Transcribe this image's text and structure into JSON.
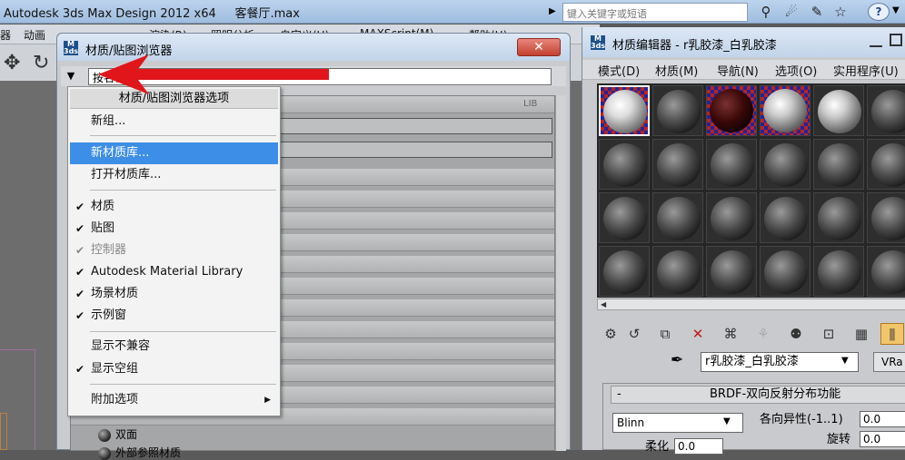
{
  "app": {
    "title": "Autodesk 3ds Max Design 2012 x64",
    "file": "客餐厅.max",
    "search_placeholder": "键入关键字或短语",
    "help": "?"
  },
  "main_menu": [
    "器",
    "动画",
    "渲染(R)",
    "照明分析",
    "自定义(U)",
    "MAXScript(M)",
    "帮助(H)"
  ],
  "browser": {
    "title": "材质/贴图浏览器",
    "close": "✕",
    "search_value": "按名称...",
    "lib_tag": "LIB",
    "rows": [
      "双面",
      "外部参照材质"
    ]
  },
  "context_menu": {
    "header": "材质/贴图浏览器选项",
    "items": [
      {
        "label": "新组...",
        "checked": false,
        "disabled": false,
        "highlighted": false
      },
      {
        "label": "新材质库...",
        "checked": false,
        "disabled": false,
        "highlighted": true
      },
      {
        "label": "打开材质库...",
        "checked": false,
        "disabled": false,
        "highlighted": false
      },
      {
        "label": "材质",
        "checked": true,
        "disabled": false,
        "highlighted": false
      },
      {
        "label": "贴图",
        "checked": true,
        "disabled": false,
        "highlighted": false
      },
      {
        "label": "控制器",
        "checked": true,
        "disabled": true,
        "highlighted": false
      },
      {
        "label": "Autodesk Material Library",
        "checked": true,
        "disabled": false,
        "highlighted": false
      },
      {
        "label": "场景材质",
        "checked": true,
        "disabled": false,
        "highlighted": false
      },
      {
        "label": "示例窗",
        "checked": true,
        "disabled": false,
        "highlighted": false
      },
      {
        "label": "显示不兼容",
        "checked": false,
        "disabled": false,
        "highlighted": false
      },
      {
        "label": "显示空组",
        "checked": true,
        "disabled": false,
        "highlighted": false
      },
      {
        "label": "附加选项",
        "checked": false,
        "disabled": false,
        "highlighted": false,
        "submenu": true
      }
    ]
  },
  "material_editor": {
    "title": "材质编辑器 - r乳胶漆_白乳胶漆",
    "menu": [
      "模式(D)",
      "材质(M)",
      "导航(N)",
      "选项(O)",
      "实用程序(U)"
    ],
    "material_name": "r乳胶漆_白乳胶漆",
    "type_button": "VRa",
    "brdf": {
      "title": "BRDF-双向反射分布功能",
      "collapse": "-",
      "type": "Blinn",
      "anisotropy_label": "各向异性(-1..1)",
      "anisotropy_value": "0.0",
      "rotation_label": "旋转",
      "rotation_value": "0.0",
      "soften_label": "柔化",
      "soften_value": "0.0"
    }
  }
}
